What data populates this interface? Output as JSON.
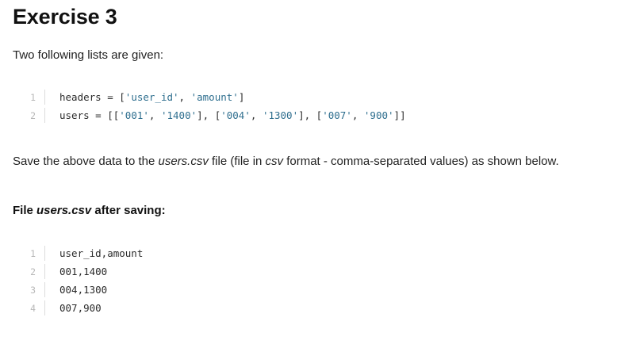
{
  "title": "Exercise 3",
  "intro": "Two following lists are given:",
  "code1": [
    {
      "n": "1",
      "pre": "headers = [",
      "parts": [
        {
          "t": "'user_id'",
          "s": true
        },
        {
          "t": ", ",
          "s": false
        },
        {
          "t": "'amount'",
          "s": true
        },
        {
          "t": "]",
          "s": false
        }
      ]
    },
    {
      "n": "2",
      "pre": "users = [[",
      "parts": [
        {
          "t": "'001'",
          "s": true
        },
        {
          "t": ", ",
          "s": false
        },
        {
          "t": "'1400'",
          "s": true
        },
        {
          "t": "], [",
          "s": false
        },
        {
          "t": "'004'",
          "s": true
        },
        {
          "t": ", ",
          "s": false
        },
        {
          "t": "'1300'",
          "s": true
        },
        {
          "t": "], [",
          "s": false
        },
        {
          "t": "'007'",
          "s": true
        },
        {
          "t": ", ",
          "s": false
        },
        {
          "t": "'900'",
          "s": true
        },
        {
          "t": "]]",
          "s": false
        }
      ]
    }
  ],
  "save": {
    "p1": "Save the above data to the ",
    "file": "users.csv",
    "p2": " file (file in ",
    "fmt": "csv",
    "p3": " format - comma-separated values) as shown below."
  },
  "file_heading": {
    "p1": "File ",
    "file": "users.csv",
    "p2": " after saving:"
  },
  "code2": [
    {
      "n": "1",
      "text": "user_id,amount"
    },
    {
      "n": "2",
      "text": "001,1400"
    },
    {
      "n": "3",
      "text": "004,1300"
    },
    {
      "n": "4",
      "text": "007,900"
    }
  ]
}
